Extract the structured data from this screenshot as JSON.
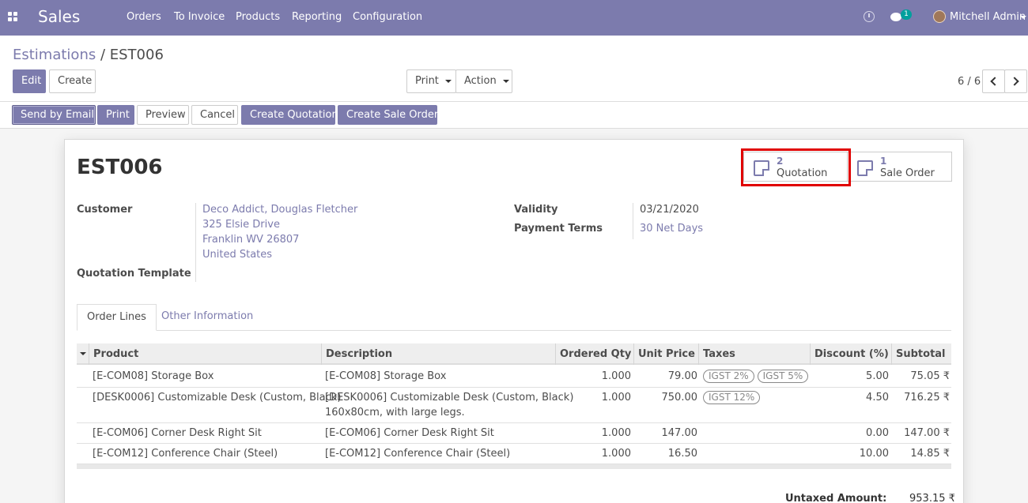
{
  "navbar": {
    "app_name": "Sales",
    "menu": [
      "Orders",
      "To Invoice",
      "Products",
      "Reporting",
      "Configuration"
    ],
    "chat_count": "1",
    "user_name": "Mitchell Admin"
  },
  "breadcrumb": {
    "parent": "Estimations",
    "separator": " / ",
    "current": "EST006"
  },
  "toolbar": {
    "edit": "Edit",
    "create": "Create",
    "print": "Print",
    "action": "Action",
    "pager": "6 / 6"
  },
  "statusbar": {
    "send_email": "Send by Email",
    "print": "Print",
    "preview": "Preview",
    "cancel": "Cancel",
    "create_quotation": "Create Quotation",
    "create_sale_order": "Create Sale Order"
  },
  "record": {
    "title": "EST006",
    "smart_buttons": [
      {
        "count": "2",
        "label": "Quotation"
      },
      {
        "count": "1",
        "label": "Sale Order"
      }
    ],
    "customer_label": "Customer",
    "customer_lines": [
      "Deco Addict, Douglas Fletcher",
      "325 Elsie Drive",
      "Franklin WV 26807",
      "United States"
    ],
    "template_label": "Quotation Template",
    "validity_label": "Validity",
    "validity": "03/21/2020",
    "terms_label": "Payment Terms",
    "terms": "30 Net Days"
  },
  "tabs": [
    "Order Lines",
    "Other Information"
  ],
  "table": {
    "headers": [
      "Product",
      "Description",
      "Ordered Qty",
      "Unit Price",
      "Taxes",
      "Discount (%)",
      "Subtotal"
    ],
    "rows": [
      {
        "product": "[E-COM08] Storage Box",
        "description": "[E-COM08] Storage Box",
        "description2": "",
        "qty": "1.000",
        "price": "79.00",
        "taxes": [
          "IGST 2%",
          "IGST 5%"
        ],
        "discount": "5.00",
        "subtotal": "75.05 ₹"
      },
      {
        "product": "[DESK0006] Customizable Desk (Custom, Black)",
        "description": "[DESK0006] Customizable Desk (Custom, Black)",
        "description2": "160x80cm, with large legs.",
        "qty": "1.000",
        "price": "750.00",
        "taxes": [
          "IGST 12%"
        ],
        "discount": "4.50",
        "subtotal": "716.25 ₹"
      },
      {
        "product": "[E-COM06] Corner Desk Right Sit",
        "description": "[E-COM06] Corner Desk Right Sit",
        "description2": "",
        "qty": "1.000",
        "price": "147.00",
        "taxes": [],
        "discount": "0.00",
        "subtotal": "147.00 ₹"
      },
      {
        "product": "[E-COM12] Conference Chair (Steel)",
        "description": "[E-COM12] Conference Chair (Steel)",
        "description2": "",
        "qty": "1.000",
        "price": "16.50",
        "taxes": [],
        "discount": "10.00",
        "subtotal": "14.85 ₹"
      }
    ]
  },
  "totals": {
    "untaxed_label": "Untaxed Amount:",
    "untaxed_value": "953.15 ₹"
  },
  "colors": {
    "brand": "#7c7bad",
    "highlight": "#e00000"
  }
}
